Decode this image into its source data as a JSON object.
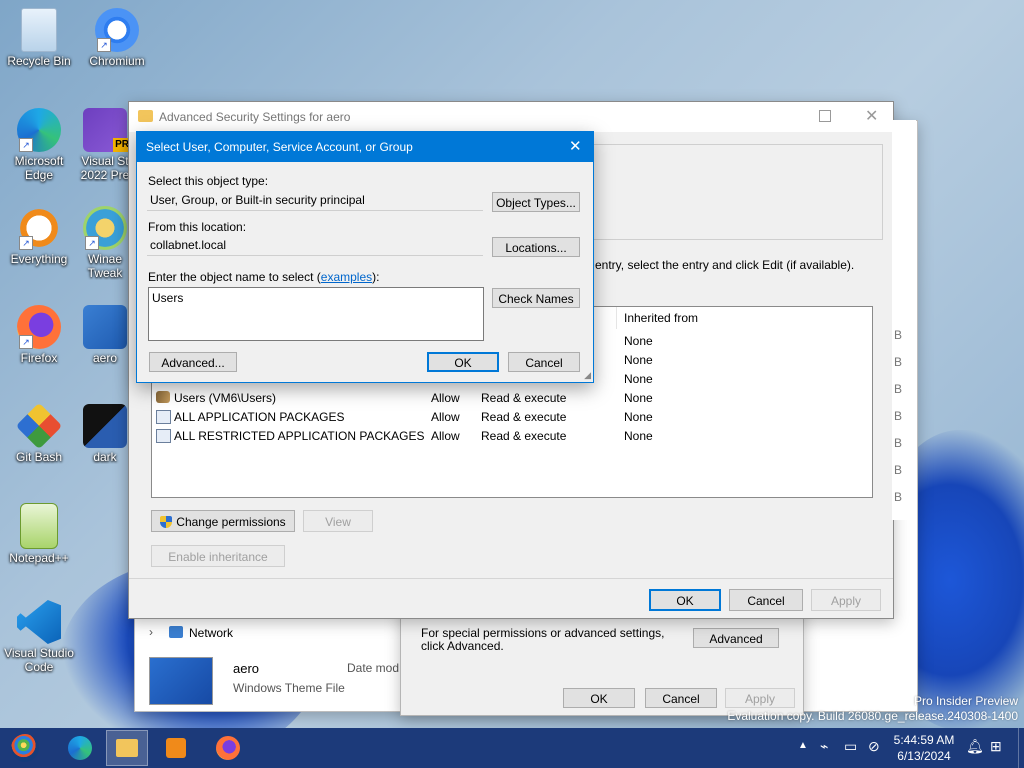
{
  "desktop": {
    "icons": [
      {
        "label": "Recycle Bin"
      },
      {
        "label": "Chromium"
      },
      {
        "label": "Microsoft Edge"
      },
      {
        "label": "Visual St 2022 Pre"
      },
      {
        "label": "Everything"
      },
      {
        "label": "Winae Tweak"
      },
      {
        "label": "Firefox"
      },
      {
        "label": "aero"
      },
      {
        "label": "Git Bash"
      },
      {
        "label": "dark"
      },
      {
        "label": "Notepad++"
      },
      {
        "label": "Visual Studio Code"
      }
    ],
    "watermark": {
      "line1": "Pro Insider Preview",
      "line2": "Evaluation copy. Build 26080.ge_release.240308-1400"
    }
  },
  "back_dialog": {
    "network_label": "Network",
    "file_name": "aero",
    "file_type": "Windows Theme File",
    "date_col": "Date mod",
    "special_text": "For special permissions or advanced settings, click Advanced.",
    "advanced": "Advanced",
    "ok": "OK",
    "cancel": "Cancel",
    "apply": "Apply"
  },
  "adv_security": {
    "title": "Advanced Security Settings for aero",
    "instruction": "entry, select the entry and click Edit (if available).",
    "col_inherited": "Inherited from",
    "rows": [
      {
        "name": "",
        "type": "",
        "access": "",
        "inherited": "None"
      },
      {
        "name": "",
        "type": "",
        "access": "",
        "inherited": "None"
      },
      {
        "name": "",
        "type": "",
        "access": "",
        "inherited": "None"
      },
      {
        "name": "Users (VM6\\Users)",
        "type": "Allow",
        "access": "Read & execute",
        "inherited": "None"
      },
      {
        "name": "ALL APPLICATION PACKAGES",
        "type": "Allow",
        "access": "Read & execute",
        "inherited": "None"
      },
      {
        "name": "ALL RESTRICTED APPLICATION PACKAGES",
        "type": "Allow",
        "access": "Read & execute",
        "inherited": "None"
      }
    ],
    "change_permissions": "Change permissions",
    "view": "View",
    "enable_inheritance": "Enable inheritance",
    "ok": "OK",
    "cancel": "Cancel",
    "apply": "Apply"
  },
  "select_dialog": {
    "title": "Select User, Computer, Service Account, or Group",
    "object_type_label": "Select this object type:",
    "object_type_value": "User, Group, or Built-in security principal",
    "object_types_btn": "Object Types...",
    "location_label": "From this location:",
    "location_value": "collabnet.local",
    "locations_btn": "Locations...",
    "enter_label_pre": "Enter the object name to select (",
    "examples_link": "examples",
    "enter_label_post": "):",
    "name_value": "Users",
    "check_names_btn": "Check Names",
    "advanced_btn": "Advanced...",
    "ok_btn": "OK",
    "cancel_btn": "Cancel"
  },
  "taskbar": {
    "time": "5:44:59 AM",
    "date": "6/13/2024"
  },
  "colors": {
    "title_blue": "#0078d7",
    "taskbar": "#1c3a7a"
  }
}
